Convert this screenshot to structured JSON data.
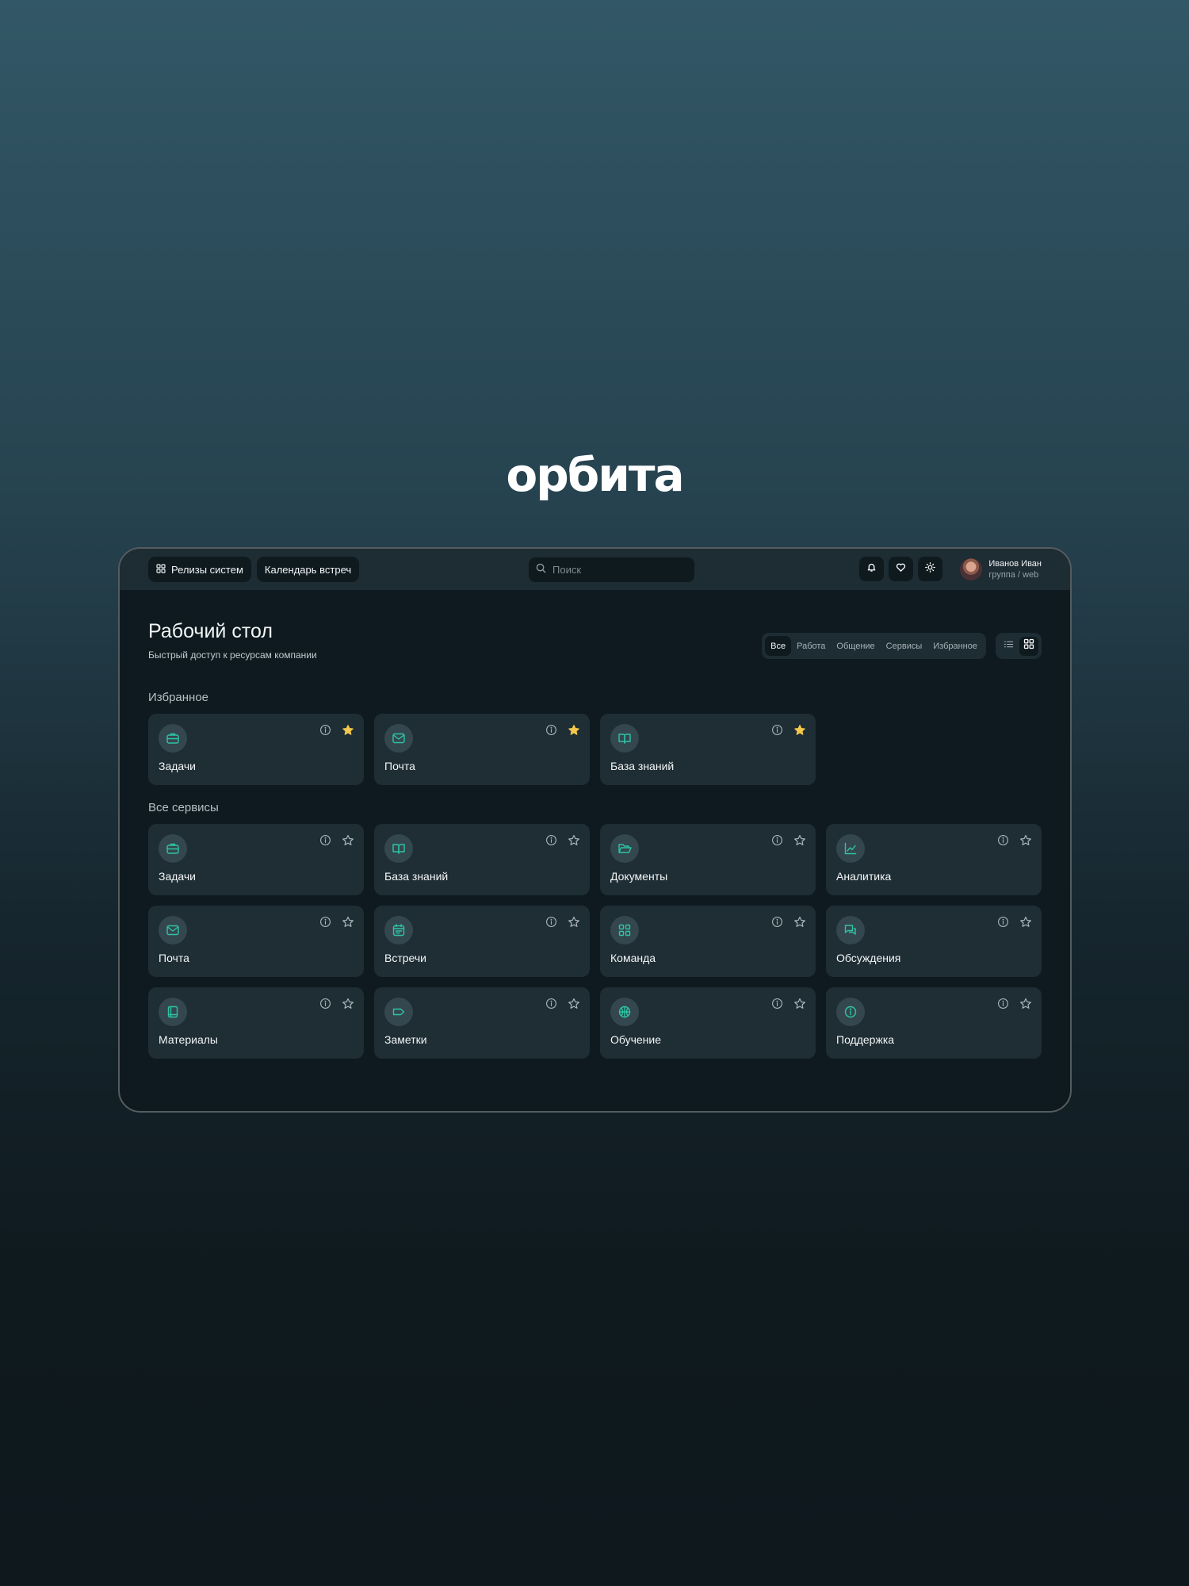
{
  "brand": {
    "logo_text": "орбита"
  },
  "topbar": {
    "buttons": [
      {
        "label": "Релизы систем",
        "icon": "grid-icon"
      },
      {
        "label": "Календарь встреч"
      }
    ],
    "search": {
      "placeholder": "Поиск",
      "value": ""
    },
    "tools": [
      "bell-icon",
      "heart-icon",
      "sun-icon"
    ],
    "user": {
      "name": "Иванов Иван",
      "group": "группа / web"
    }
  },
  "page": {
    "title": "Рабочий стол",
    "subtitle": "Быстрый доступ к ресурсам компании"
  },
  "filters": {
    "items": [
      "Все",
      "Работа",
      "Общение",
      "Сервисы",
      "Избранное"
    ],
    "active": "Все"
  },
  "view_mode": {
    "options": [
      "list",
      "grid"
    ],
    "active": "grid"
  },
  "favorites": {
    "title": "Избранное",
    "items": [
      {
        "label": "Задачи",
        "icon": "briefcase-icon",
        "starred": true
      },
      {
        "label": "Почта",
        "icon": "mail-icon",
        "starred": true
      },
      {
        "label": "База знаний",
        "icon": "book-open-icon",
        "starred": true
      }
    ]
  },
  "services": {
    "title": "Все сервисы",
    "items": [
      {
        "label": "Задачи",
        "icon": "briefcase-icon",
        "starred": false
      },
      {
        "label": "База знаний",
        "icon": "book-open-icon",
        "starred": false
      },
      {
        "label": "Документы",
        "icon": "folder-open-icon",
        "starred": false
      },
      {
        "label": "Аналитика",
        "icon": "chart-line-icon",
        "starred": false
      },
      {
        "label": "Почта",
        "icon": "mail-icon",
        "starred": false
      },
      {
        "label": "Встречи",
        "icon": "calendar-icon",
        "starred": false
      },
      {
        "label": "Команда",
        "icon": "grid-icon",
        "starred": false
      },
      {
        "label": "Обсуждения",
        "icon": "chat-icon",
        "starred": false
      },
      {
        "label": "Материалы",
        "icon": "book-icon",
        "starred": false
      },
      {
        "label": "Заметки",
        "icon": "tag-icon",
        "starred": false
      },
      {
        "label": "Обучение",
        "icon": "globe-icon",
        "starred": false
      },
      {
        "label": "Поддержка",
        "icon": "info-icon",
        "starred": false
      }
    ]
  },
  "colors": {
    "accent": "#2ec4a6",
    "star_active": "#f5c84c",
    "card_bg": "#1f2d34",
    "window_bg": "#0e1a1f"
  }
}
